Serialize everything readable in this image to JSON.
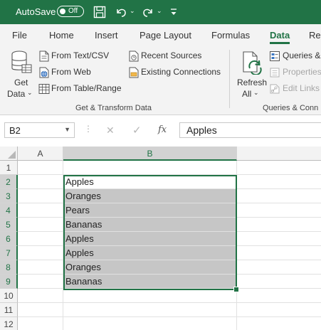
{
  "titlebar": {
    "autosave_label": "AutoSave",
    "autosave_state": "Off",
    "accent_color": "#217346"
  },
  "tabs": [
    "File",
    "Home",
    "Insert",
    "Page Layout",
    "Formulas",
    "Data",
    "Re"
  ],
  "active_tab": "Data",
  "ribbon": {
    "get_data": {
      "line1": "Get",
      "line2": "Data"
    },
    "from_text_csv": "From Text/CSV",
    "from_web": "From Web",
    "from_table_range": "From Table/Range",
    "recent_sources": "Recent Sources",
    "existing_connections": "Existing Connections",
    "group1_label": "Get & Transform Data",
    "refresh": {
      "line1": "Refresh",
      "line2": "All"
    },
    "queries": "Queries &",
    "properties": "Properties",
    "edit_links": "Edit Links",
    "group2_label": "Queries & Conn"
  },
  "formula_bar": {
    "name_box": "B2",
    "cancel_icon": "✕",
    "enter_icon": "✓",
    "fx_label": "fx",
    "value": "Apples"
  },
  "grid": {
    "columns": [
      "A",
      "B"
    ],
    "rows": [
      "1",
      "2",
      "3",
      "4",
      "5",
      "6",
      "7",
      "8",
      "9",
      "10",
      "11",
      "12"
    ],
    "column_b_values": [
      "",
      "Apples",
      "Oranges",
      "Pears",
      "Bananas",
      "Apples",
      "Apples",
      "Oranges",
      "Bananas",
      "",
      "",
      ""
    ]
  }
}
